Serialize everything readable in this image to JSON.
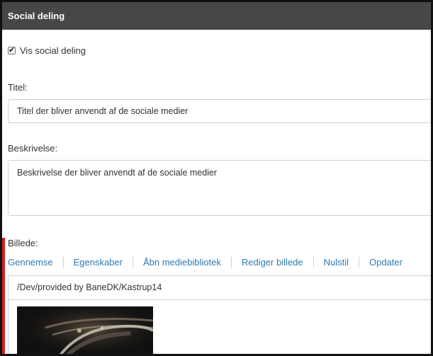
{
  "header": {
    "title": "Social deling"
  },
  "show_social": {
    "label": "Vis social deling",
    "checked": true
  },
  "title_field": {
    "label": "Titel:",
    "value": "Titel der bliver anvendt af de sociale medier"
  },
  "description_field": {
    "label": "Beskrivelse:",
    "value": "Beskrivelse der bliver anvendt af de sociale medier"
  },
  "image_field": {
    "label": "Billede:",
    "toolbar": {
      "browse": "Gennemse",
      "properties": "Egenskaber",
      "open_library": "Åbn mediebibliotek",
      "edit_image": "Rediger billede",
      "reset": "Nulstil",
      "update": "Opdater"
    },
    "path": "/Dev/provided by BaneDK/Kastrup14"
  },
  "colors": {
    "header_bg": "#474747",
    "link": "#2f7ab3",
    "required_marker": "#d42020"
  }
}
